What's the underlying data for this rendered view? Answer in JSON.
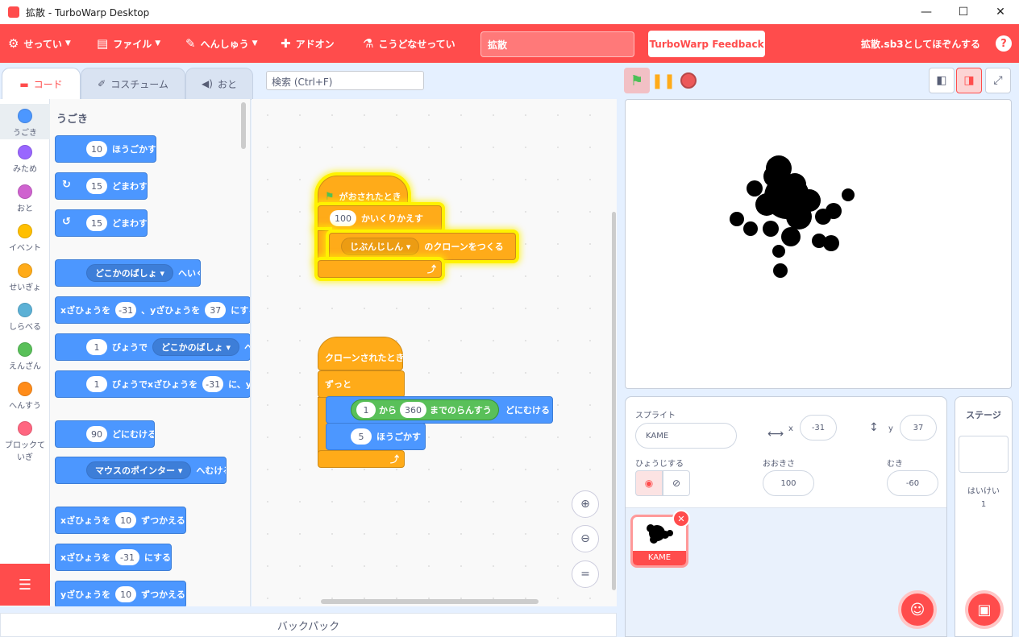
{
  "window": {
    "title": "拡散 - TurboWarp Desktop",
    "minimize": "—",
    "maximize": "☐",
    "close": "✕"
  },
  "menu": {
    "settings": "せってい",
    "file": "ファイル",
    "edit": "へんしゅう",
    "addons": "アドオン",
    "howto": "こうどなせってい",
    "project_title": "拡散",
    "feedback": "TurboWarp Feedback",
    "save": "拡散.sb3としてほぞんする",
    "help": "?"
  },
  "tabs": {
    "code": "コード",
    "costumes": "コスチューム",
    "sounds": "おと"
  },
  "search": {
    "placeholder": "検索 (Ctrl+F)"
  },
  "categories": [
    {
      "label": "うごき",
      "color": "#4c97ff"
    },
    {
      "label": "みため",
      "color": "#9966ff"
    },
    {
      "label": "おと",
      "color": "#cf63cf"
    },
    {
      "label": "イベント",
      "color": "#ffbf00"
    },
    {
      "label": "せいぎょ",
      "color": "#ffab19"
    },
    {
      "label": "しらべる",
      "color": "#5cb1d6"
    },
    {
      "label": "えんざん",
      "color": "#59c059"
    },
    {
      "label": "へんすう",
      "color": "#ff8c1a"
    },
    {
      "label": "ブロックていぎ",
      "color": "#ff6680"
    }
  ],
  "palette": {
    "heading": "うごき",
    "b1": {
      "in": "10",
      "text": "ほうごかす"
    },
    "b2": {
      "in": "15",
      "text": "どまわす"
    },
    "b3": {
      "in": "15",
      "text": "どまわす"
    },
    "b4": {
      "dd": "どこかのばしょ ▾",
      "text": "へいく"
    },
    "b5": {
      "t1": "xざひょうを",
      "in1": "-31",
      "t2": "、yざひょうを",
      "in2": "37",
      "t3": "にする"
    },
    "b6": {
      "in": "1",
      "t1": "びょうで",
      "dd": "どこかのばしょ ▾",
      "t2": "へい"
    },
    "b7": {
      "in": "1",
      "t1": "びょうでxざひょうを",
      "in2": "-31",
      "t2": "に、y"
    },
    "b8": {
      "in": "90",
      "text": "どにむける"
    },
    "b9": {
      "dd": "マウスのポインター ▾",
      "text": "へむける"
    },
    "b10": {
      "t1": "xざひょうを",
      "in": "10",
      "t2": "ずつかえる"
    },
    "b11": {
      "t1": "xざひょうを",
      "in": "-31",
      "t2": "にする"
    },
    "b12": {
      "t1": "yざひょうを",
      "in": "10",
      "t2": "ずつかえる"
    }
  },
  "script1": {
    "hat": "がおされたとき",
    "repeat_count": "100",
    "repeat": "かいくりかえす",
    "dd": "じぶんじしん ▾",
    "clone": "のクローンをつくる"
  },
  "script2": {
    "hat": "クローンされたとき",
    "forever": "ずっと",
    "from": "1",
    "from_t": "から",
    "to": "360",
    "rand_t": "までのらんすう",
    "point": "どにむける",
    "move_in": "5",
    "move": "ほうごかす"
  },
  "sprite": {
    "label_sprite": "スプライト",
    "name": "KAME",
    "label_x": "x",
    "x": "-31",
    "label_y": "y",
    "y": "37",
    "label_show": "ひょうじする",
    "label_size": "おおきさ",
    "size": "100",
    "label_dir": "むき",
    "dir": "-60",
    "thumb_name": "KAME"
  },
  "stagepanel": {
    "title": "ステージ",
    "backdrops_label": "はいけい",
    "backdrops": "1"
  },
  "backpack": "バックパック"
}
